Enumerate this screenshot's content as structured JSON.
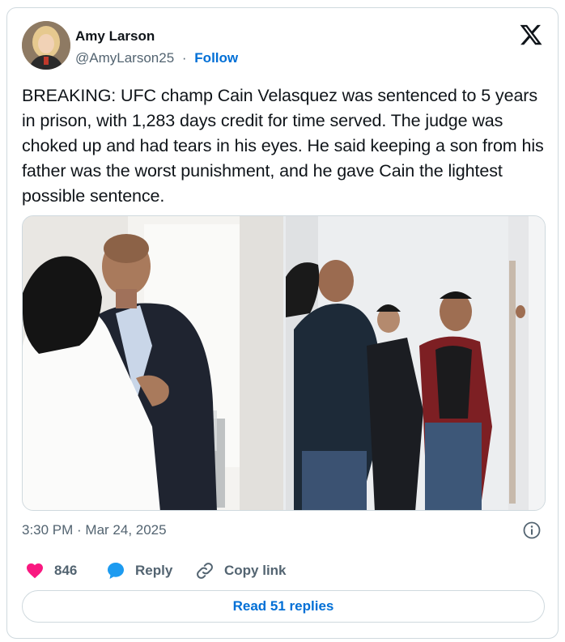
{
  "author": {
    "name": "Amy Larson",
    "handle": "@AmyLarson25",
    "separator": "·",
    "follow_label": "Follow"
  },
  "tweet": {
    "text": "BREAKING: UFC champ Cain Velasquez was sentenced to 5 years in prison, with 1,283 days credit for time served. The judge was choked up and had tears in his eyes. He said keeping a son from his father was the worst punishment, and he gave Cain the lightest possible sentence.",
    "timestamp": "3:30 PM · Mar 24, 2025"
  },
  "actions": {
    "like_count": "846",
    "reply_label": "Reply",
    "copy_label": "Copy link"
  },
  "read_replies_label": "Read 51 replies",
  "colors": {
    "accent": "#006fd6",
    "like": "#f91880",
    "reply": "#1d9bf0",
    "secondary_text": "#536471",
    "border": "#cfd9de"
  },
  "icons": [
    "x-logo-icon",
    "heart-icon",
    "reply-bubble-icon",
    "link-icon",
    "info-icon"
  ]
}
